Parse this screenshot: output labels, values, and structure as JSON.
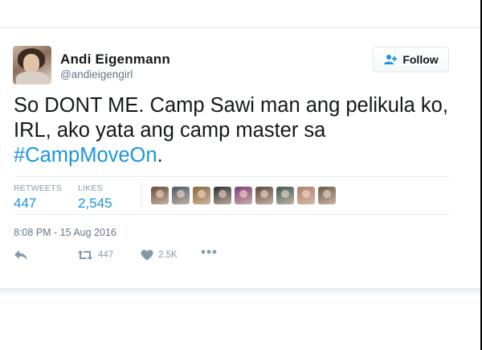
{
  "user": {
    "name": "Andi Eigenmann",
    "handle": "@andieigengirl"
  },
  "follow_button": {
    "label": "Follow"
  },
  "tweet": {
    "text_lines": [
      "So DONT ME. Camp Sawi man ang pelikula ko,",
      "IRL, ako yata ang camp master sa"
    ],
    "hashtag": "#CampMoveOn",
    "trailing": "."
  },
  "stats": {
    "retweets_label": "RETWEETS",
    "retweets_value": "447",
    "likes_label": "LIKES",
    "likes_value": "2,545"
  },
  "likers": [
    {
      "icon": "user-avatar",
      "color": "#6b4e3d"
    },
    {
      "icon": "user-avatar",
      "color": "#4a5a6b"
    },
    {
      "icon": "user-avatar",
      "color": "#8a6a3a"
    },
    {
      "icon": "user-avatar",
      "color": "#2e2e36"
    },
    {
      "icon": "user-avatar",
      "color": "#7b3f7a"
    },
    {
      "icon": "user-avatar",
      "color": "#5a4a40"
    },
    {
      "icon": "user-avatar",
      "color": "#3e5a55"
    },
    {
      "icon": "user-avatar",
      "color": "#b08070"
    },
    {
      "icon": "user-avatar",
      "color": "#6e5c4c"
    }
  ],
  "timestamp": "8:08 PM - 15 Aug 2016",
  "actions": {
    "reply_icon": "reply-icon",
    "retweet_icon": "retweet-icon",
    "retweet_count": "447",
    "like_icon": "heart-icon",
    "like_count": "2.5K",
    "more_icon": "more-icon"
  },
  "colors": {
    "link_blue": "#1b95e0",
    "muted": "#8899a6",
    "divider": "#e6ecf0"
  }
}
